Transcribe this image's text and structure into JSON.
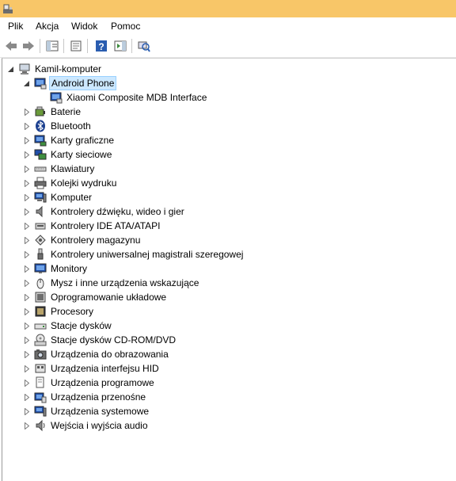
{
  "menu": [
    "Plik",
    "Akcja",
    "Widok",
    "Pomoc"
  ],
  "toolbar": [
    "back-icon",
    "forward-icon",
    "show-hide-tree-icon",
    "properties-icon",
    "help-icon",
    "action-pane-icon",
    "scan-hardware-icon"
  ],
  "tree": {
    "root": "Kamil-komputer",
    "expanded_category": "Android Phone",
    "child_device": "Xiaomi Composite MDB Interface",
    "categories": [
      "Baterie",
      "Bluetooth",
      "Karty graficzne",
      "Karty sieciowe",
      "Klawiatury",
      "Kolejki wydruku",
      "Komputer",
      "Kontrolery dźwięku, wideo i gier",
      "Kontrolery IDE ATA/ATAPI",
      "Kontrolery magazynu",
      "Kontrolery uniwersalnej magistrali szeregowej",
      "Monitory",
      "Mysz i inne urządzenia wskazujące",
      "Oprogramowanie układowe",
      "Procesory",
      "Stacje dysków",
      "Stacje dysków CD-ROM/DVD",
      "Urządzenia do obrazowania",
      "Urządzenia interfejsu HID",
      "Urządzenia programowe",
      "Urządzenia przenośne",
      "Urządzenia systemowe",
      "Wejścia i wyjścia audio"
    ]
  },
  "colors": {
    "titlebar": "#f8c668",
    "selection": "#cce8ff",
    "selection_border": "#99d1ff"
  }
}
